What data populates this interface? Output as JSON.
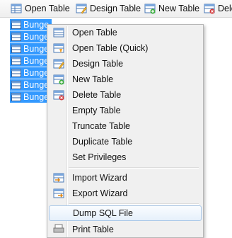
{
  "toolbar": {
    "open_table": "Open Table",
    "design_table": "Design Table",
    "new_table": "New Table",
    "delete_table": "Dele"
  },
  "tree": {
    "items": [
      {
        "label": "Bunge"
      },
      {
        "label": "Bunge"
      },
      {
        "label": "Bunge"
      },
      {
        "label": "Bunge"
      },
      {
        "label": "Bunge"
      },
      {
        "label": "Bunge"
      },
      {
        "label": "Bunge"
      }
    ]
  },
  "menu": {
    "open_table": "Open Table",
    "open_table_quick": "Open Table (Quick)",
    "design_table": "Design Table",
    "new_table": "New Table",
    "delete_table": "Delete Table",
    "empty_table": "Empty Table",
    "truncate_table": "Truncate Table",
    "duplicate_table": "Duplicate Table",
    "set_privileges": "Set Privileges",
    "import_wizard": "Import Wizard",
    "export_wizard": "Export Wizard",
    "dump_sql_file": "Dump SQL File",
    "print_table": "Print Table"
  },
  "colors": {
    "selection": "#3399ff",
    "menu_bg": "#f0f0f0",
    "highlight_border": "#a9c7e8"
  }
}
